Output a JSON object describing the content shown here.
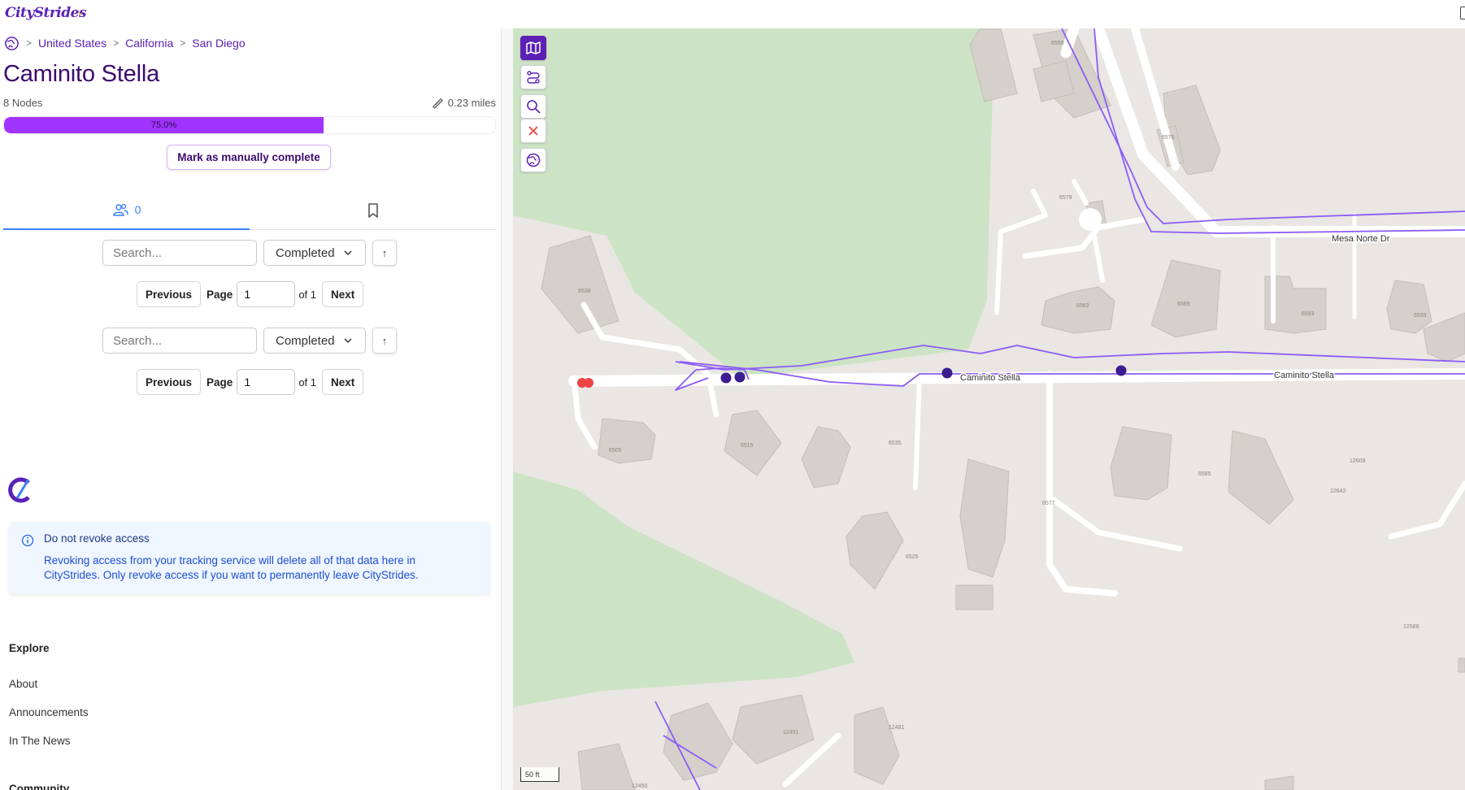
{
  "brand": {
    "logo_text": "CityStrides"
  },
  "breadcrumb": {
    "items": [
      "United States",
      "California",
      "San Diego"
    ],
    "separator": ">"
  },
  "street": {
    "name": "Caminito Stella",
    "nodes_text": "8 Nodes",
    "distance_text": "0.23 miles",
    "progress": {
      "percent": 75.0,
      "label": "75.0%"
    }
  },
  "actions": {
    "manual_complete": "Mark as manually complete"
  },
  "tabs": {
    "runners_count": "0"
  },
  "lists": [
    {
      "search_placeholder": "Search...",
      "filter": "Completed",
      "sort_symbol": "↑",
      "previous": "Previous",
      "page_label": "Page",
      "page_value": "1",
      "of_label": "of 1",
      "next": "Next"
    },
    {
      "search_placeholder": "Search...",
      "filter": "Completed",
      "sort_symbol": "↑",
      "previous": "Previous",
      "page_label": "Page",
      "page_value": "1",
      "of_label": "of 1",
      "next": "Next"
    }
  ],
  "alert": {
    "title": "Do not revoke access",
    "body": "Revoking access from your tracking service will delete all of that data here in CityStrides. Only revoke access if you want to permanently leave CityStrides."
  },
  "footer": {
    "explore_heading": "Explore",
    "explore_links": [
      "About",
      "Announcements",
      "In The News"
    ],
    "community_heading": "Community"
  },
  "map": {
    "street_labels": [
      "Caminito Stella",
      "Caminito Stella",
      "Mesa Norte Dr"
    ],
    "house_numbers": [
      "6555",
      "6575",
      "6579",
      "6583",
      "6589",
      "6593",
      "6599",
      "6538",
      "6505",
      "6515",
      "6535",
      "6577",
      "6585",
      "12608",
      "12642",
      "6525",
      "12586",
      "12491",
      "12481",
      "12450"
    ],
    "scale_label": "50 ft",
    "tools": [
      "map-icon",
      "routes-icon",
      "search-icon",
      "close-icon",
      "globe-icon"
    ]
  },
  "colors": {
    "brand_purple": "#5b21b6",
    "progress_fill": "#a133ff",
    "activity_line": "#8b5cf6",
    "node_complete": "#3b1d8f",
    "node_incomplete": "#ef4444",
    "park": "#cde3c5",
    "land": "#e9e6e3",
    "building": "#d5d0cb"
  }
}
